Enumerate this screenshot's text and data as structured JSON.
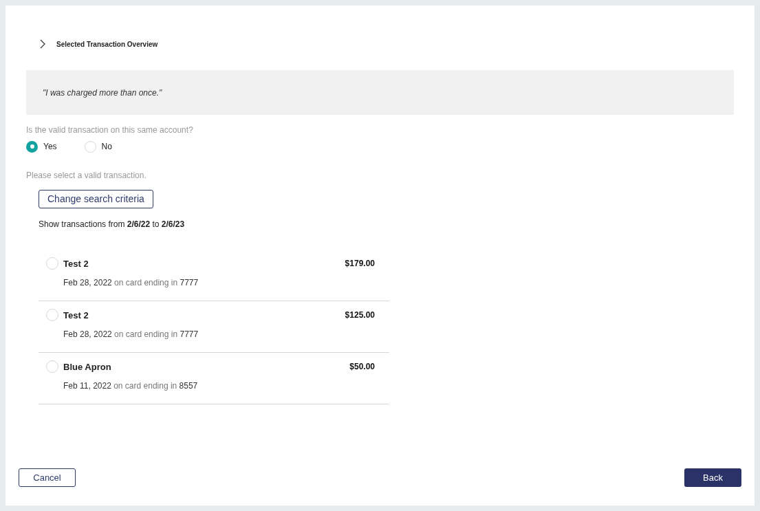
{
  "section": {
    "title": "Selected Transaction Overview",
    "expanded": false
  },
  "quote": "\"I was charged more than once.\"",
  "question": {
    "label": "Is the valid transaction on this same account?",
    "options": [
      {
        "label": "Yes",
        "selected": true
      },
      {
        "label": "No",
        "selected": false
      }
    ]
  },
  "instruction": "Please select a valid transaction.",
  "change_button": "Change search criteria",
  "range_text": "Show transactions from **2/6/22** to **2/6/23**",
  "transactions": [
    {
      "merchant": "Test 2",
      "amount": "$179.00",
      "date": "Feb 28, 2022",
      "connector": "on card ending in",
      "card": "7777",
      "selected": false
    },
    {
      "merchant": "Test 2",
      "amount": "$125.00",
      "date": "Feb 28, 2022",
      "connector": "on card ending in",
      "card": "7777",
      "selected": false
    },
    {
      "merchant": "Blue Apron",
      "amount": "$50.00",
      "date": "Feb 11, 2022",
      "connector": "on card ending in",
      "card": "8557",
      "selected": false
    }
  ],
  "buttons": {
    "cancel": "Cancel",
    "back": "Back"
  }
}
